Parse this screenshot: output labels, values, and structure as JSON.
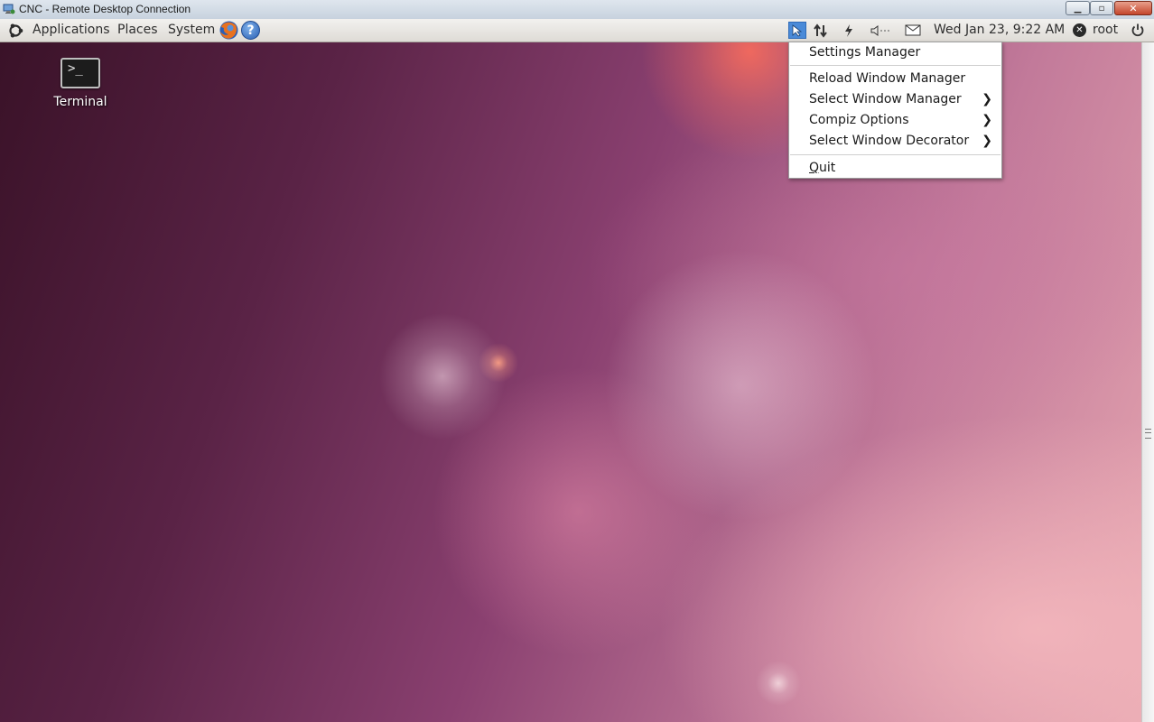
{
  "window": {
    "title": "CNC - Remote Desktop Connection",
    "min_glyph": "▁",
    "max_glyph": "▫",
    "close_glyph": "✕"
  },
  "panel": {
    "menus": [
      "Applications",
      "Places",
      "System"
    ],
    "help_glyph": "?",
    "clock": "Wed Jan 23,  9:22 AM",
    "user": "root",
    "tray_icons": [
      "pointer-icon",
      "network-arrows-icon",
      "power-bolt-icon",
      "volume-icon",
      "mail-icon"
    ]
  },
  "desktop": {
    "icons": [
      {
        "label": "Terminal",
        "glyph": ">_"
      }
    ]
  },
  "context_menu": {
    "items": [
      {
        "label": "Settings Manager",
        "submenu": false
      },
      {
        "label": "Reload Window Manager",
        "submenu": false
      },
      {
        "label": "Select Window Manager",
        "submenu": true
      },
      {
        "label": "Compiz Options",
        "submenu": true
      },
      {
        "label": "Select Window Decorator",
        "submenu": true
      },
      {
        "label": "Quit",
        "submenu": false
      }
    ],
    "arrow_glyph": "❯"
  },
  "colors": {
    "tray_active": "#4a8ad8",
    "wallpaper_dark": "#3a1228",
    "wallpaper_light": "#e6a6b0"
  }
}
